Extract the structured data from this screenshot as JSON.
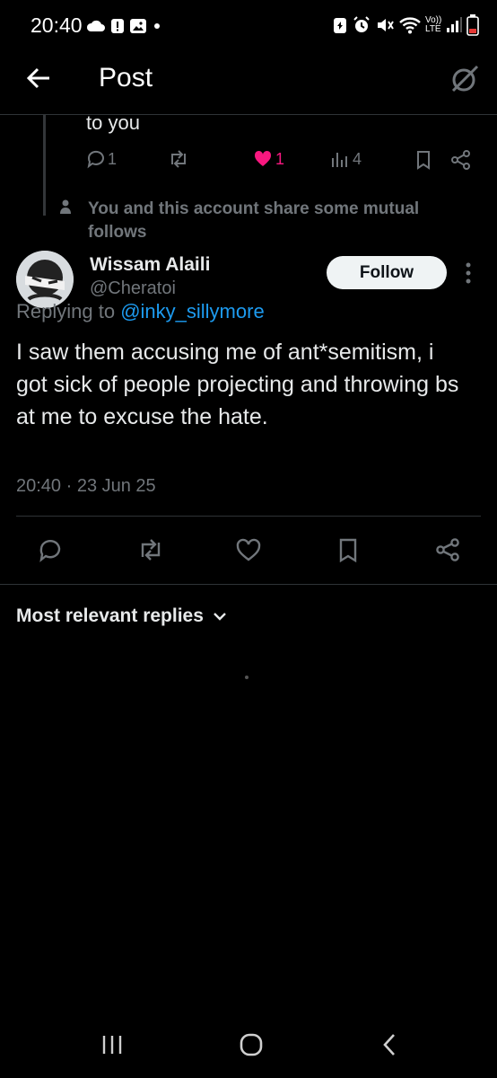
{
  "status_bar": {
    "time": "20:40",
    "net_label_top": "Vo))",
    "net_label_bottom": "LTE"
  },
  "header": {
    "title": "Post"
  },
  "prev_tweet": {
    "text": "to you",
    "replies": "1",
    "likes": "1",
    "views": "4"
  },
  "social_context": "You and this account share some mutual follows",
  "tweet": {
    "author_name": "Wissam Alaili",
    "handle": "@Cheratoi",
    "follow_label": "Follow",
    "replying_prefix": "Replying to",
    "replying_to": "@inky_sillymore",
    "text": "I saw them accusing me of ant*semitism, i got sick of people projecting and throwing bs at me to excuse the hate.",
    "timestamp": "20:40 · 23 Jun 25"
  },
  "replies_sort": {
    "label": "Most relevant replies"
  },
  "colors": {
    "background": "#000000",
    "like_pink": "#f91880",
    "link_blue": "#1d9bf0",
    "muted": "#71767b"
  }
}
